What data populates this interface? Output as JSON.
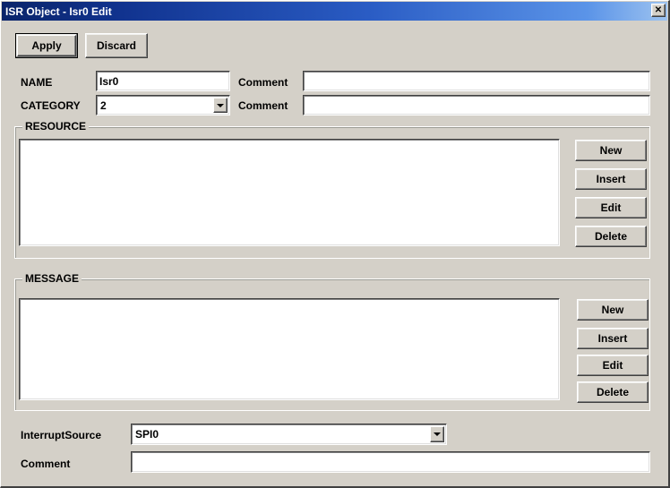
{
  "window": {
    "title": "ISR Object - Isr0 Edit",
    "close_label": "✕",
    "background_color": "#d4d0c8",
    "titlebar_gradient_from": "#0a246a",
    "titlebar_gradient_to": "#9dc3f0"
  },
  "toolbar": {
    "apply_label": "Apply",
    "discard_label": "Discard"
  },
  "fields": {
    "name_label": "NAME",
    "name_value": "Isr0",
    "name_comment_label": "Comment",
    "name_comment_value": "",
    "category_label": "CATEGORY",
    "category_value": "2",
    "category_comment_label": "Comment",
    "category_comment_value": ""
  },
  "resource": {
    "group_label": "RESOURCE",
    "items": [],
    "buttons": [
      {
        "label": "New"
      },
      {
        "label": "Insert"
      },
      {
        "label": "Edit"
      },
      {
        "label": "Delete"
      }
    ]
  },
  "message": {
    "group_label": "MESSAGE",
    "items": [],
    "buttons": [
      {
        "label": "New"
      },
      {
        "label": "Insert"
      },
      {
        "label": "Edit"
      },
      {
        "label": "Delete"
      }
    ]
  },
  "footer": {
    "interrupt_source_label": "InterruptSource",
    "interrupt_source_value": "SPI0",
    "comment_label": "Comment",
    "comment_value": ""
  }
}
